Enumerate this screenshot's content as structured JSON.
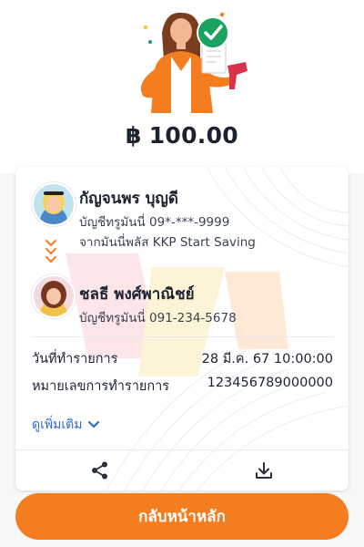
{
  "transaction": {
    "currency_symbol": "฿",
    "amount": "100.00"
  },
  "sender": {
    "name": "กัญจนพร บุญดี",
    "account_line": "บัญชีทรูมันนี่ 09*-***-9999",
    "source_line": "จากมันนี่พลัส KKP Start Saving"
  },
  "receiver": {
    "name": "ชลธี พงศ์พาณิชย์",
    "account_line": "บัญชีทรูมันนี่ 091-234-5678"
  },
  "details": {
    "date_label": "วันที่ทำรายการ",
    "date_value": "28 มี.ค. 67 10:00:00",
    "ref_label": "หมายเลขการทำรายการ",
    "ref_value": "123456789000000",
    "more_label": "ดูเพิ่มเติม"
  },
  "actions": {
    "share_icon": "share-icon",
    "download_icon": "download-icon"
  },
  "footer": {
    "home_label": "กลับหน้าหลัก"
  },
  "colors": {
    "accent_orange": "#f47d20",
    "success_green": "#1aa260",
    "link_blue": "#2d6ad6"
  }
}
